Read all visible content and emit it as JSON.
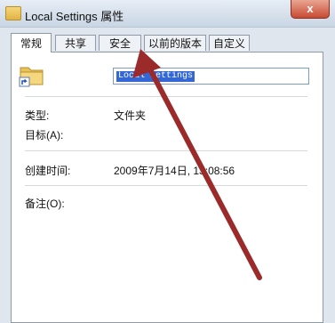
{
  "window": {
    "title": "Local Settings 属性",
    "close_label": "x"
  },
  "tabs": [
    {
      "label": "常规",
      "active": true
    },
    {
      "label": "共享"
    },
    {
      "label": "安全"
    },
    {
      "label": "以前的版本"
    },
    {
      "label": "自定义"
    }
  ],
  "general": {
    "name_value": "Local Settings",
    "type_label": "类型:",
    "type_value": "文件夹",
    "target_label": "目标(A):",
    "created_label": "创建时间:",
    "created_value": "2009年7月14日, 13:08:56",
    "comment_label": "备注(O):"
  },
  "annotation": {
    "arrow_color": "#9b2a2a",
    "points_to": "安全"
  }
}
